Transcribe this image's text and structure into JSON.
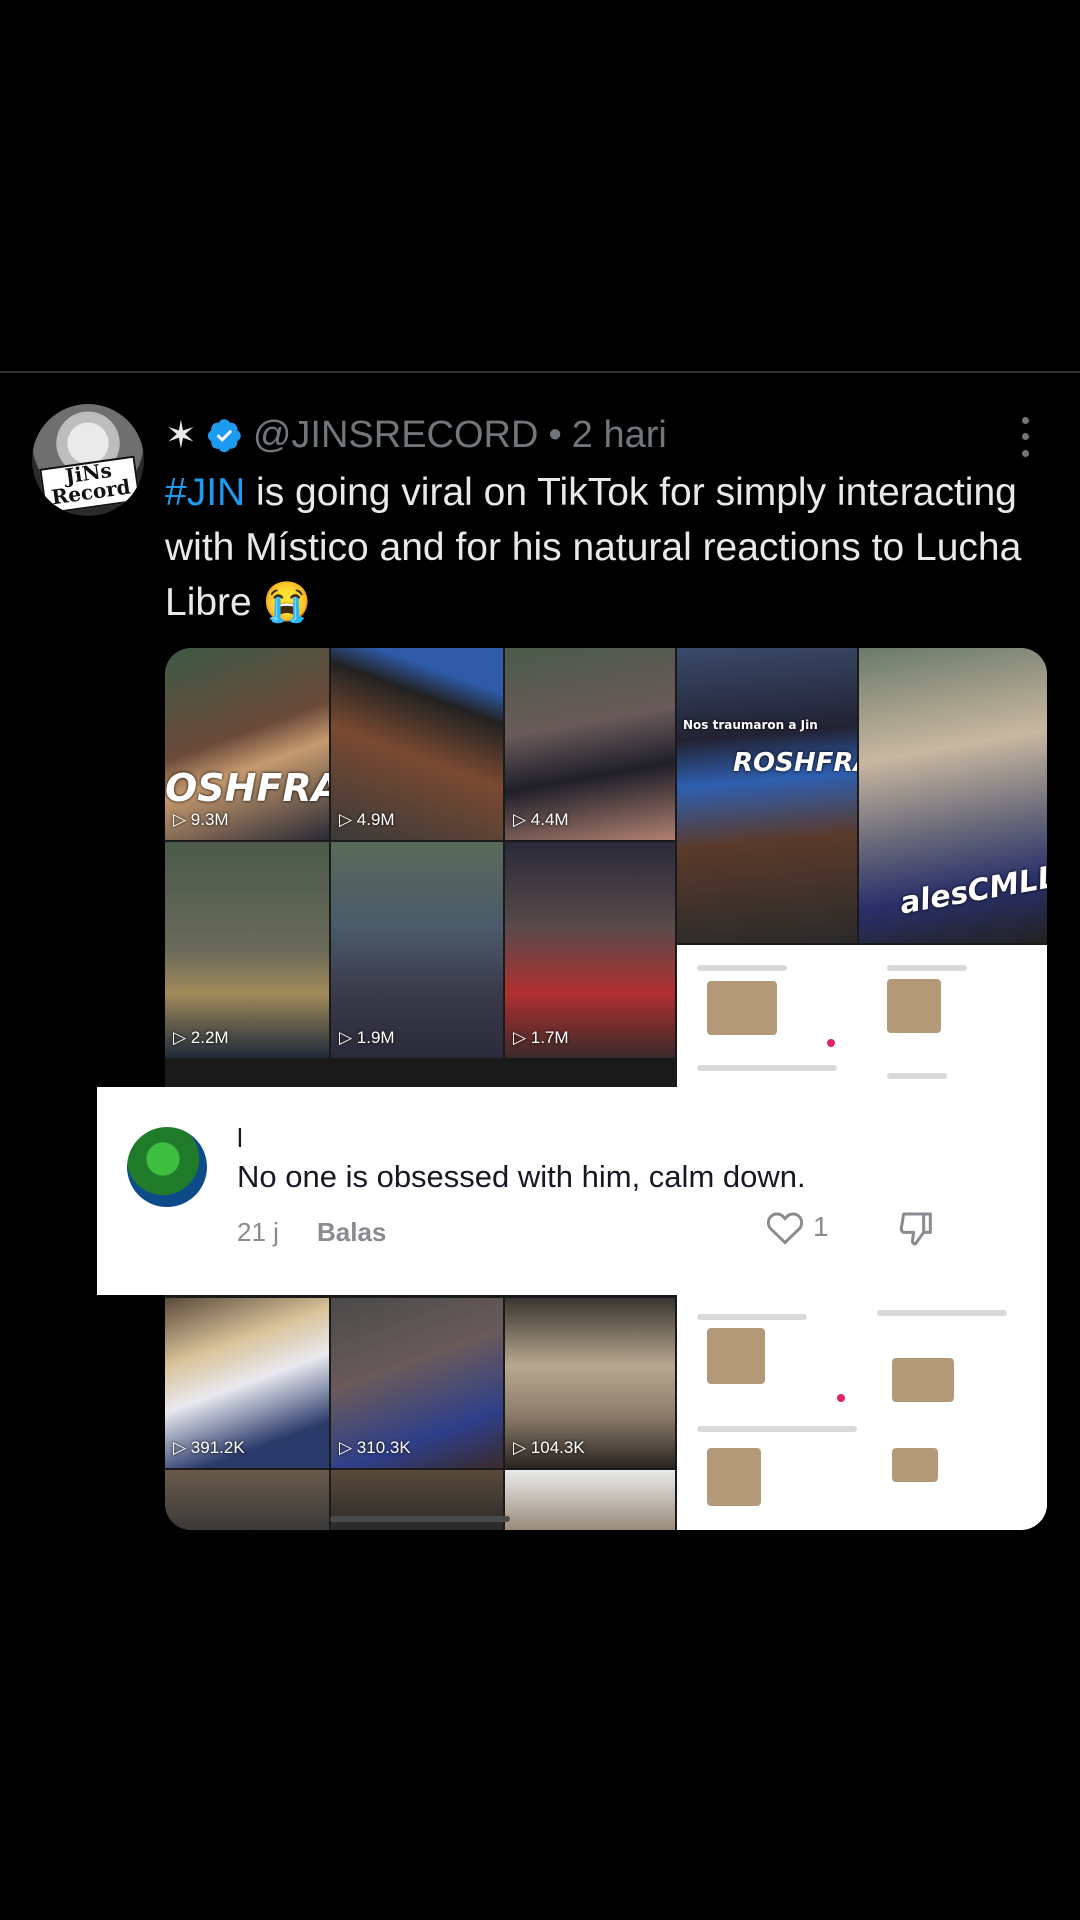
{
  "tweet": {
    "star": "✶",
    "handle": "@JINSRECORD",
    "separator": "•",
    "time": "2 hari",
    "hashtag": "#JIN",
    "text": " is going viral on TikTok for simply interacting with Místico and for his natural reactions to Lucha Libre 😭",
    "avatar_logo": "JiNs Record"
  },
  "media": {
    "views_row1": [
      "9.3M",
      "4.9M",
      "4.4M"
    ],
    "views_row2": [
      "2.2M",
      "1.9M",
      "1.7M"
    ],
    "views_row3": [
      "391.2K",
      "310.3K",
      "104.3K"
    ],
    "band_text_1": "OSHFRAN",
    "band_text_2": "ROSHFRAN",
    "band_text_3": "alesCMLL",
    "caption_1": "Nos traumaron a Jin",
    "colors": {
      "accent": "#1d9bf0",
      "verified": "#1d9bf0"
    }
  },
  "comment": {
    "username": "l",
    "text": "No one is obsessed with him, calm down.",
    "age": "21 j",
    "reply_label": "Balas",
    "likes": "1"
  }
}
